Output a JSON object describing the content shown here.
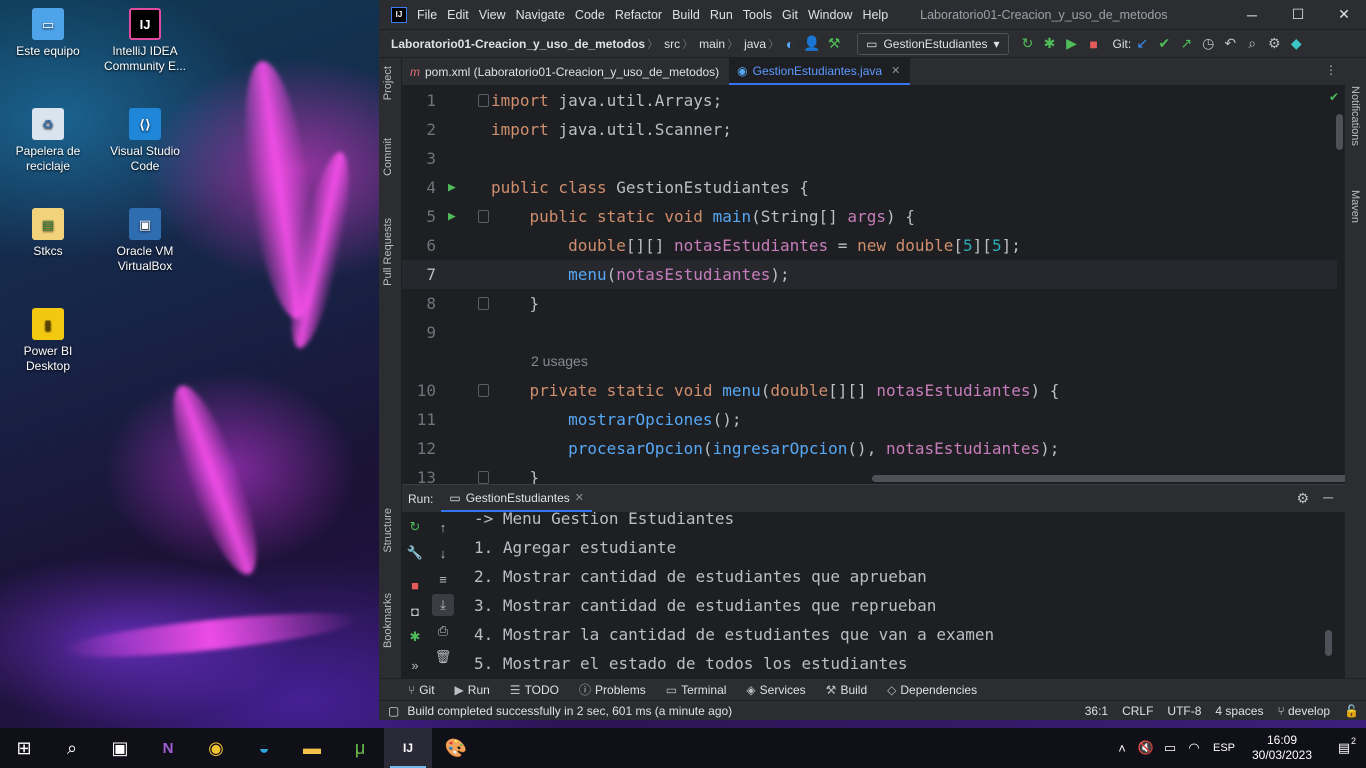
{
  "desktop": {
    "icons": [
      {
        "label": "Este equipo",
        "icon": "computer-icon"
      },
      {
        "label": "IntelliJ IDEA Community E...",
        "icon": "intellij-icon"
      },
      {
        "label": "Papelera de reciclaje",
        "icon": "recycle-bin-icon"
      },
      {
        "label": "Visual Studio Code",
        "icon": "vscode-icon"
      },
      {
        "label": "Stkcs",
        "icon": "file-icon"
      },
      {
        "label": "Oracle VM VirtualBox",
        "icon": "virtualbox-icon"
      },
      {
        "label": "Power BI Desktop",
        "icon": "powerbi-icon"
      }
    ]
  },
  "ide": {
    "menu": [
      "File",
      "Edit",
      "View",
      "Navigate",
      "Code",
      "Refactor",
      "Build",
      "Run",
      "Tools",
      "Git",
      "Window",
      "Help"
    ],
    "window_title": "Laboratorio01-Creacion_y_uso_de_metodos",
    "breadcrumbs": [
      "Laboratorio01-Creacion_y_uso_de_metodos",
      "src",
      "main",
      "java"
    ],
    "run_config": "GestionEstudiantes",
    "git_label": "Git:",
    "left_tabs": [
      "Project",
      "Commit",
      "Pull Requests",
      "Structure",
      "Bookmarks"
    ],
    "right_tabs": [
      "Notifications",
      "Maven"
    ],
    "tabs": [
      {
        "label": "pom.xml (Laboratorio01-Creacion_y_uso_de_metodos)",
        "icon": "maven-file-icon"
      },
      {
        "label": "GestionEstudiantes.java",
        "icon": "java-class-icon",
        "active": true
      }
    ],
    "editor": {
      "usage_hint": "2 usages",
      "lines": [
        {
          "n": "1",
          "tokens": [
            [
              "kw",
              "import "
            ],
            [
              "plain",
              "java.util.Arrays;"
            ]
          ]
        },
        {
          "n": "2",
          "tokens": [
            [
              "kw",
              "import "
            ],
            [
              "plain",
              "java.util.Scanner;"
            ]
          ]
        },
        {
          "n": "3",
          "tokens": []
        },
        {
          "n": "4",
          "tokens": [
            [
              "kw",
              "public class "
            ],
            [
              "plain",
              "GestionEstudiantes {"
            ]
          ]
        },
        {
          "n": "5",
          "tokens": [
            [
              "kw",
              "    public static void "
            ],
            [
              "fn",
              "main"
            ],
            [
              "plain",
              "(String[] "
            ],
            [
              "var",
              "args"
            ],
            [
              "plain",
              ") {"
            ]
          ]
        },
        {
          "n": "6",
          "tokens": [
            [
              "kw",
              "        double"
            ],
            [
              "plain",
              "[][] "
            ],
            [
              "var",
              "notasEstudiantes"
            ],
            [
              "plain",
              " = "
            ],
            [
              "kw",
              "new double"
            ],
            [
              "plain",
              "["
            ],
            [
              "num",
              "5"
            ],
            [
              "plain",
              "]["
            ],
            [
              "num",
              "5"
            ],
            [
              "plain",
              "];"
            ]
          ]
        },
        {
          "n": "7",
          "tokens": [
            [
              "fn",
              "        menu"
            ],
            [
              "plain",
              "("
            ],
            [
              "var",
              "notasEstudiantes"
            ],
            [
              "plain",
              ");"
            ]
          ]
        },
        {
          "n": "8",
          "tokens": [
            [
              "plain",
              "    }"
            ]
          ]
        },
        {
          "n": "9",
          "tokens": []
        },
        {
          "n": "10",
          "tokens": [
            [
              "kw",
              "    private static void "
            ],
            [
              "fn",
              "menu"
            ],
            [
              "plain",
              "("
            ],
            [
              "kw",
              "double"
            ],
            [
              "plain",
              "[][] "
            ],
            [
              "var",
              "notasEstudiantes"
            ],
            [
              "plain",
              ") {"
            ]
          ]
        },
        {
          "n": "11",
          "tokens": [
            [
              "fn",
              "        mostrarOpciones"
            ],
            [
              "plain",
              "();"
            ]
          ]
        },
        {
          "n": "12",
          "tokens": [
            [
              "fn",
              "        procesarOpcion"
            ],
            [
              "plain",
              "("
            ],
            [
              "fn",
              "ingresarOpcion"
            ],
            [
              "plain",
              "(), "
            ],
            [
              "var",
              "notasEstudiantes"
            ],
            [
              "plain",
              ");"
            ]
          ]
        },
        {
          "n": "13",
          "tokens": [
            [
              "plain",
              "    }"
            ]
          ]
        }
      ]
    },
    "run_panel": {
      "label": "Run:",
      "tab": "GestionEstudiantes",
      "console": [
        "-> Menu Gestion Estudiantes",
        "1. Agregar estudiante",
        "2. Mostrar cantidad de estudiantes que aprueban",
        "3. Mostrar cantidad de estudiantes que reprueban",
        "4. Mostrar la cantidad de estudiantes que van a examen",
        "5. Mostrar el estado de todos los estudiantes"
      ]
    },
    "bottom_tools": [
      {
        "label": "Git",
        "icon": "git-branch-icon"
      },
      {
        "label": "Run",
        "icon": "run-icon"
      },
      {
        "label": "TODO",
        "icon": "list-icon"
      },
      {
        "label": "Problems",
        "icon": "info-icon"
      },
      {
        "label": "Terminal",
        "icon": "terminal-icon"
      },
      {
        "label": "Services",
        "icon": "services-icon"
      },
      {
        "label": "Build",
        "icon": "hammer-icon"
      },
      {
        "label": "Dependencies",
        "icon": "layers-icon"
      }
    ],
    "status": {
      "message": "Build completed successfully in 2 sec, 601 ms (a minute ago)",
      "position": "36:1",
      "line_sep": "CRLF",
      "encoding": "UTF-8",
      "indent": "4 spaces",
      "branch": "develop"
    }
  },
  "taskbar": {
    "language": "ESP",
    "time": "16:09",
    "date": "30/03/2023",
    "notifications": "2"
  }
}
